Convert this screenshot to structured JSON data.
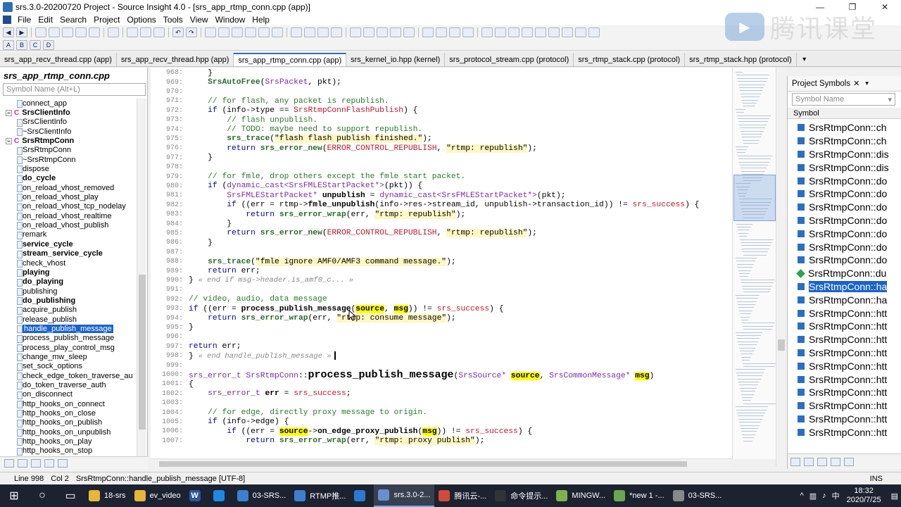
{
  "window": {
    "title": "srs.3.0-20200720 Project - Source Insight 4.0 - [srs_app_rtmp_conn.cpp (app)]",
    "controls": [
      "—",
      "❐",
      "✕"
    ]
  },
  "menu": [
    "File",
    "Edit",
    "Search",
    "Project",
    "Options",
    "Tools",
    "View",
    "Window",
    "Help"
  ],
  "watermark": {
    "logo_glyph": "▶",
    "text": "腾讯课堂"
  },
  "tabs": [
    {
      "label": "srs_app_recv_thread.cpp (app)",
      "active": false
    },
    {
      "label": "srs_app_recv_thread.hpp (app)",
      "active": false
    },
    {
      "label": "srs_app_rtmp_conn.cpp (app)",
      "active": true
    },
    {
      "label": "srs_kernel_io.hpp (kernel)",
      "active": false
    },
    {
      "label": "srs_protocol_stream.cpp (protocol)",
      "active": false
    },
    {
      "label": "srs_rtmp_stack.cpp (protocol)",
      "active": false
    },
    {
      "label": "srs_rtmp_stack.hpp (protocol)",
      "active": false
    }
  ],
  "tab_overflow": "▾",
  "left_panel": {
    "title": "srs_app_rtmp_conn.cpp",
    "search_placeholder": "Symbol Name (Alt+L)",
    "tree": [
      {
        "label": "connect_app",
        "type": "member"
      },
      {
        "label": "SrsClientInfo",
        "type": "class",
        "expander": "−",
        "icon": "C"
      },
      {
        "label": "SrsClientInfo",
        "type": "member"
      },
      {
        "label": "~SrsClientInfo",
        "type": "member"
      },
      {
        "label": "SrsRtmpConn",
        "type": "class",
        "expander": "−",
        "icon": "C"
      },
      {
        "label": "SrsRtmpConn",
        "type": "member"
      },
      {
        "label": "~SrsRtmpConn",
        "type": "member"
      },
      {
        "label": "dispose",
        "type": "member"
      },
      {
        "label": "do_cycle",
        "type": "member",
        "bold": true
      },
      {
        "label": "on_reload_vhost_removed",
        "type": "member"
      },
      {
        "label": "on_reload_vhost_play",
        "type": "member"
      },
      {
        "label": "on_reload_vhost_tcp_nodelay",
        "type": "member"
      },
      {
        "label": "on_reload_vhost_realtime",
        "type": "member"
      },
      {
        "label": "on_reload_vhost_publish",
        "type": "member"
      },
      {
        "label": "remark",
        "type": "member"
      },
      {
        "label": "service_cycle",
        "type": "member",
        "bold": true
      },
      {
        "label": "stream_service_cycle",
        "type": "member",
        "bold": true
      },
      {
        "label": "check_vhost",
        "type": "member"
      },
      {
        "label": "playing",
        "type": "member",
        "bold": true
      },
      {
        "label": "do_playing",
        "type": "member",
        "bold": true
      },
      {
        "label": "publishing",
        "type": "member"
      },
      {
        "label": "do_publishing",
        "type": "member",
        "bold": true
      },
      {
        "label": "acquire_publish",
        "type": "member"
      },
      {
        "label": "release_publish",
        "type": "member"
      },
      {
        "label": "handle_publish_message",
        "type": "member",
        "selected": true
      },
      {
        "label": "process_publish_message",
        "type": "member"
      },
      {
        "label": "process_play_control_msg",
        "type": "member"
      },
      {
        "label": "change_mw_sleep",
        "type": "member"
      },
      {
        "label": "set_sock_options",
        "type": "member"
      },
      {
        "label": "check_edge_token_traverse_au",
        "type": "member"
      },
      {
        "label": "do_token_traverse_auth",
        "type": "member"
      },
      {
        "label": "on_disconnect",
        "type": "member"
      },
      {
        "label": "http_hooks_on_connect",
        "type": "member"
      },
      {
        "label": "http_hooks_on_close",
        "type": "member"
      },
      {
        "label": "http_hooks_on_publish",
        "type": "member"
      },
      {
        "label": "http_hooks_on_unpublish",
        "type": "member"
      },
      {
        "label": "http_hooks_on_play",
        "type": "member"
      },
      {
        "label": "http_hooks_on_stop",
        "type": "member"
      }
    ]
  },
  "code": [
    {
      "n": "968:",
      "html": "    }"
    },
    {
      "n": "969:",
      "html": "    <span class='fn' style='color:#2a6a2a'>SrsAutoFree</span>(<span class='ty'>SrsPacket</span>, pkt);"
    },
    {
      "n": "970:",
      "html": ""
    },
    {
      "n": "971:",
      "html": "    <span class='cm'>// for flash, any packet is republish.</span>"
    },
    {
      "n": "972:",
      "html": "    <span class='kw'>if</span> (info-&gt;type == <span class='red'>SrsRtmpConnFlashPublish</span>) {"
    },
    {
      "n": "973:",
      "html": "        <span class='cm'>// flash unpublish.</span>"
    },
    {
      "n": "974:",
      "html": "        <span class='cm'>// TODO: maybe need to support republish.</span>"
    },
    {
      "n": "975:",
      "html": "        <span class='fn' style='color:#2a6a2a'>srs_trace</span>(<span class='str'>\"flash flash publish finished.\"</span>);"
    },
    {
      "n": "976:",
      "html": "        <span class='kw'>return</span> <span class='fn' style='color:#2a6a2a'>srs_error_new</span>(<span class='red'>ERROR_CONTROL_REPUBLISH</span>, <span class='str'>\"rtmp: republish\"</span>);"
    },
    {
      "n": "977:",
      "html": "    }"
    },
    {
      "n": "978:",
      "html": ""
    },
    {
      "n": "979:",
      "html": "    <span class='cm'>// for fmle, drop others except the fmle start packet.</span>"
    },
    {
      "n": "980:",
      "html": "    <span class='kw'>if</span> (<span class='ty'>dynamic_cast&lt;SrsFMLEStartPacket*&gt;</span>(pkt)) {"
    },
    {
      "n": "981:",
      "html": "        <span class='ty'>SrsFMLEStartPacket*</span> <b>unpublish</b> = <span class='ty'>dynamic_cast&lt;SrsFMLEStartPacket*&gt;</span>(pkt);"
    },
    {
      "n": "982:",
      "html": "        <span class='kw'>if</span> ((err = rtmp-&gt;<b>fmle_unpublish</b>(info-&gt;res-&gt;stream_id, unpublish-&gt;transaction_id)) != <span class='red'>srs_success</span>) {"
    },
    {
      "n": "983:",
      "html": "            <span class='kw'>return</span> <span class='fn' style='color:#2a6a2a'>srs_error_wrap</span>(err, <span class='str'>\"rtmp: republish\"</span>);"
    },
    {
      "n": "984:",
      "html": "        }"
    },
    {
      "n": "985:",
      "html": "        <span class='kw'>return</span> <span class='fn' style='color:#2a6a2a'>srs_error_new</span>(<span class='red'>ERROR_CONTROL_REPUBLISH</span>, <span class='str'>\"rtmp: republish\"</span>);"
    },
    {
      "n": "986:",
      "html": "    }"
    },
    {
      "n": "987:",
      "html": ""
    },
    {
      "n": "988:",
      "html": "    <span class='fn' style='color:#2a6a2a'>srs_trace</span>(<span class='str'>\"fmle ignore AMF0/AMF3 command message.\"</span>);"
    },
    {
      "n": "989:",
      "html": "    <span class='kw'>return</span> err;"
    },
    {
      "n": "990:",
      "html": "} <span class='fold'>« end if msg-&gt;header.is_amf0_c... »</span>"
    },
    {
      "n": "991:",
      "html": ""
    },
    {
      "n": "992:",
      "html": "<span class='cm'>// video, audio, data message</span>"
    },
    {
      "n": "993:",
      "html": "<span class='kw'>if</span> ((err = <b>process_publish_message</b>(<span class='hl'>source</span>, <span class='hl'>msg</span>)) != <span class='red'>srs_success</span>) {"
    },
    {
      "n": "994:",
      "html": "    <span class='kw'>return</span> <span class='fn' style='color:#2a6a2a'>srs_error_wrap</span>(err, <span class='str'>\"rtmp: consume message\"</span>);"
    },
    {
      "n": "995:",
      "html": "}"
    },
    {
      "n": "996:",
      "html": ""
    },
    {
      "n": "997:",
      "html": "<span class='kw'>return</span> err;"
    },
    {
      "n": "998:",
      "html": "} <span class='fold'>« end handle_publish_message »</span><span class='cursor-caret'></span>"
    },
    {
      "n": "999:",
      "html": ""
    },
    {
      "n": "1000:",
      "html": "<span class='ty'>srs_error_t</span> <span class='ty'>SrsRtmpConn</span>::<span class='big-fn'>process_publish_message</span>(<span class='ty'>SrsSource*</span> <span class='hl'>source</span>, <span class='ty'>SrsCommonMessage*</span> <span class='hl'>msg</span>)"
    },
    {
      "n": "1001:",
      "html": "{"
    },
    {
      "n": "1002:",
      "html": "    <span class='ty'>srs_error_t</span> <b>err</b> = <span class='red'>srs_success</span>;"
    },
    {
      "n": "1003:",
      "html": ""
    },
    {
      "n": "1004:",
      "html": "    <span class='cm'>// for edge, directly proxy message to origin.</span>"
    },
    {
      "n": "1005:",
      "html": "    <span class='kw'>if</span> (info-&gt;edge) {"
    },
    {
      "n": "1006:",
      "html": "        <span class='kw'>if</span> ((err = <span class='hl'>source</span>-&gt;<b>on_edge_proxy_publish</b>(<span class='hl'>msg</span>)) != <span class='red'>srs_success</span>) {"
    },
    {
      "n": "1007:",
      "html": "            <span class='kw'>return</span> <span class='fn' style='color:#2a6a2a'>srs_error_wrap</span>(err, <span class='str'>\"rtmp: proxy publish\"</span>);"
    }
  ],
  "right_panel": {
    "title": "Project Symbols",
    "close": "✕",
    "dropdown": "▾",
    "search_placeholder": "Symbol Name",
    "column": "Symbol",
    "symbols": [
      {
        "label": "SrsRtmpConn::ch",
        "icon": "sq"
      },
      {
        "label": "SrsRtmpConn::ch",
        "icon": "sq"
      },
      {
        "label": "SrsRtmpConn::dis",
        "icon": "sq"
      },
      {
        "label": "SrsRtmpConn::dis",
        "icon": "sq"
      },
      {
        "label": "SrsRtmpConn::do",
        "icon": "sq"
      },
      {
        "label": "SrsRtmpConn::do",
        "icon": "sq"
      },
      {
        "label": "SrsRtmpConn::do",
        "icon": "sq"
      },
      {
        "label": "SrsRtmpConn::do",
        "icon": "sq"
      },
      {
        "label": "SrsRtmpConn::do",
        "icon": "sq"
      },
      {
        "label": "SrsRtmpConn::do",
        "icon": "sq"
      },
      {
        "label": "SrsRtmpConn::do",
        "icon": "sq"
      },
      {
        "label": "SrsRtmpConn::du",
        "icon": "dm"
      },
      {
        "label": "SrsRtmpConn::ha",
        "icon": "sq",
        "selected": true
      },
      {
        "label": "SrsRtmpConn::ha",
        "icon": "sq"
      },
      {
        "label": "SrsRtmpConn::htt",
        "icon": "sq"
      },
      {
        "label": "SrsRtmpConn::htt",
        "icon": "sq"
      },
      {
        "label": "SrsRtmpConn::htt",
        "icon": "sq"
      },
      {
        "label": "SrsRtmpConn::htt",
        "icon": "sq"
      },
      {
        "label": "SrsRtmpConn::htt",
        "icon": "sq"
      },
      {
        "label": "SrsRtmpConn::htt",
        "icon": "sq"
      },
      {
        "label": "SrsRtmpConn::htt",
        "icon": "sq"
      },
      {
        "label": "SrsRtmpConn::htt",
        "icon": "sq"
      },
      {
        "label": "SrsRtmpConn::htt",
        "icon": "sq"
      },
      {
        "label": "SrsRtmpConn::htt",
        "icon": "sq"
      }
    ]
  },
  "status": {
    "line": "Line 998",
    "col": "Col 2",
    "symbol": "SrsRtmpConn::handle_publish_message [UTF-8]",
    "mode": "INS"
  },
  "taskbar": {
    "items": [
      {
        "label": "18-srs",
        "color": "#e8b43a"
      },
      {
        "label": "ev_video",
        "color": "#e8b43a"
      },
      {
        "label": "",
        "color": "#2b579a",
        "glyph": "W"
      },
      {
        "label": "",
        "color": "#1e88e5"
      },
      {
        "label": "03-SRS...",
        "color": "#3c7fd0"
      },
      {
        "label": "RTMP推...",
        "color": "#3c7fd0"
      },
      {
        "label": "",
        "color": "#2a7ad1"
      },
      {
        "label": "srs.3.0-2...",
        "color": "#6a8fcf",
        "active": true
      },
      {
        "label": "腾讯云-...",
        "color": "#d14b3a"
      },
      {
        "label": "命令提示...",
        "color": "#333"
      },
      {
        "label": "MINGW...",
        "color": "#7fb24b"
      },
      {
        "label": "*new 1 -...",
        "color": "#6aa84f"
      },
      {
        "label": "03-SRS...",
        "color": "#888"
      }
    ],
    "time": "18:32",
    "date": "2020/7/25",
    "lang": "中"
  }
}
